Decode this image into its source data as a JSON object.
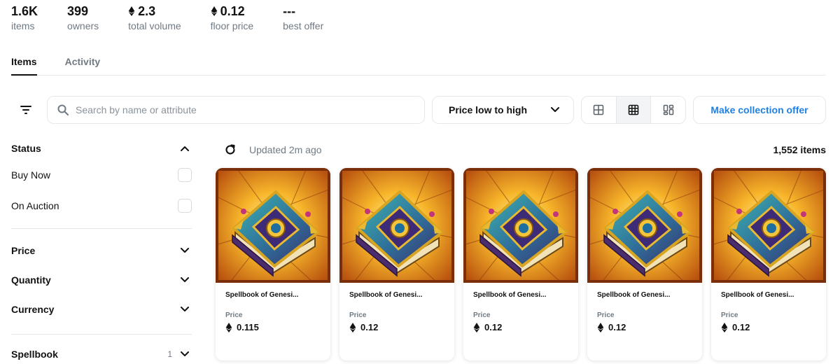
{
  "stats": [
    {
      "value": "1.6K",
      "label": "items",
      "eth": false
    },
    {
      "value": "399",
      "label": "owners",
      "eth": false
    },
    {
      "value": "2.3",
      "label": "total volume",
      "eth": true
    },
    {
      "value": "0.12",
      "label": "floor price",
      "eth": true
    },
    {
      "value": "---",
      "label": "best offer",
      "eth": false
    }
  ],
  "tabs": [
    {
      "label": "Items",
      "active": true
    },
    {
      "label": "Activity",
      "active": false
    }
  ],
  "toolbar": {
    "filter_icon": "filter-lines-icon",
    "search_placeholder": "Search by name or attribute",
    "search_value": "",
    "sort_label": "Price low to high",
    "views": [
      {
        "icon": "grid-large-icon",
        "active": false
      },
      {
        "icon": "grid-small-icon",
        "active": true
      },
      {
        "icon": "mosaic-icon",
        "active": false
      }
    ],
    "offer_label": "Make collection offer"
  },
  "sidebar": {
    "status": {
      "title": "Status",
      "expanded": true,
      "options": [
        "Buy Now",
        "On Auction"
      ]
    },
    "sections": [
      "Price",
      "Quantity",
      "Currency"
    ],
    "spellbook": {
      "title": "Spellbook",
      "count": "1"
    }
  },
  "results": {
    "updated": "Updated 2m ago",
    "count": "1,552 items"
  },
  "cards": [
    {
      "name": "Spellbook of Genesi...",
      "price_label": "Price",
      "price": "0.115"
    },
    {
      "name": "Spellbook of Genesi...",
      "price_label": "Price",
      "price": "0.12"
    },
    {
      "name": "Spellbook of Genesi...",
      "price_label": "Price",
      "price": "0.12"
    },
    {
      "name": "Spellbook of Genesi...",
      "price_label": "Price",
      "price": "0.12"
    },
    {
      "name": "Spellbook of Genesi...",
      "price_label": "Price",
      "price": "0.12"
    }
  ],
  "colors": {
    "accent": "#2081e2",
    "muted": "#707a83",
    "border": "#e5e8eb",
    "text": "#121212"
  }
}
